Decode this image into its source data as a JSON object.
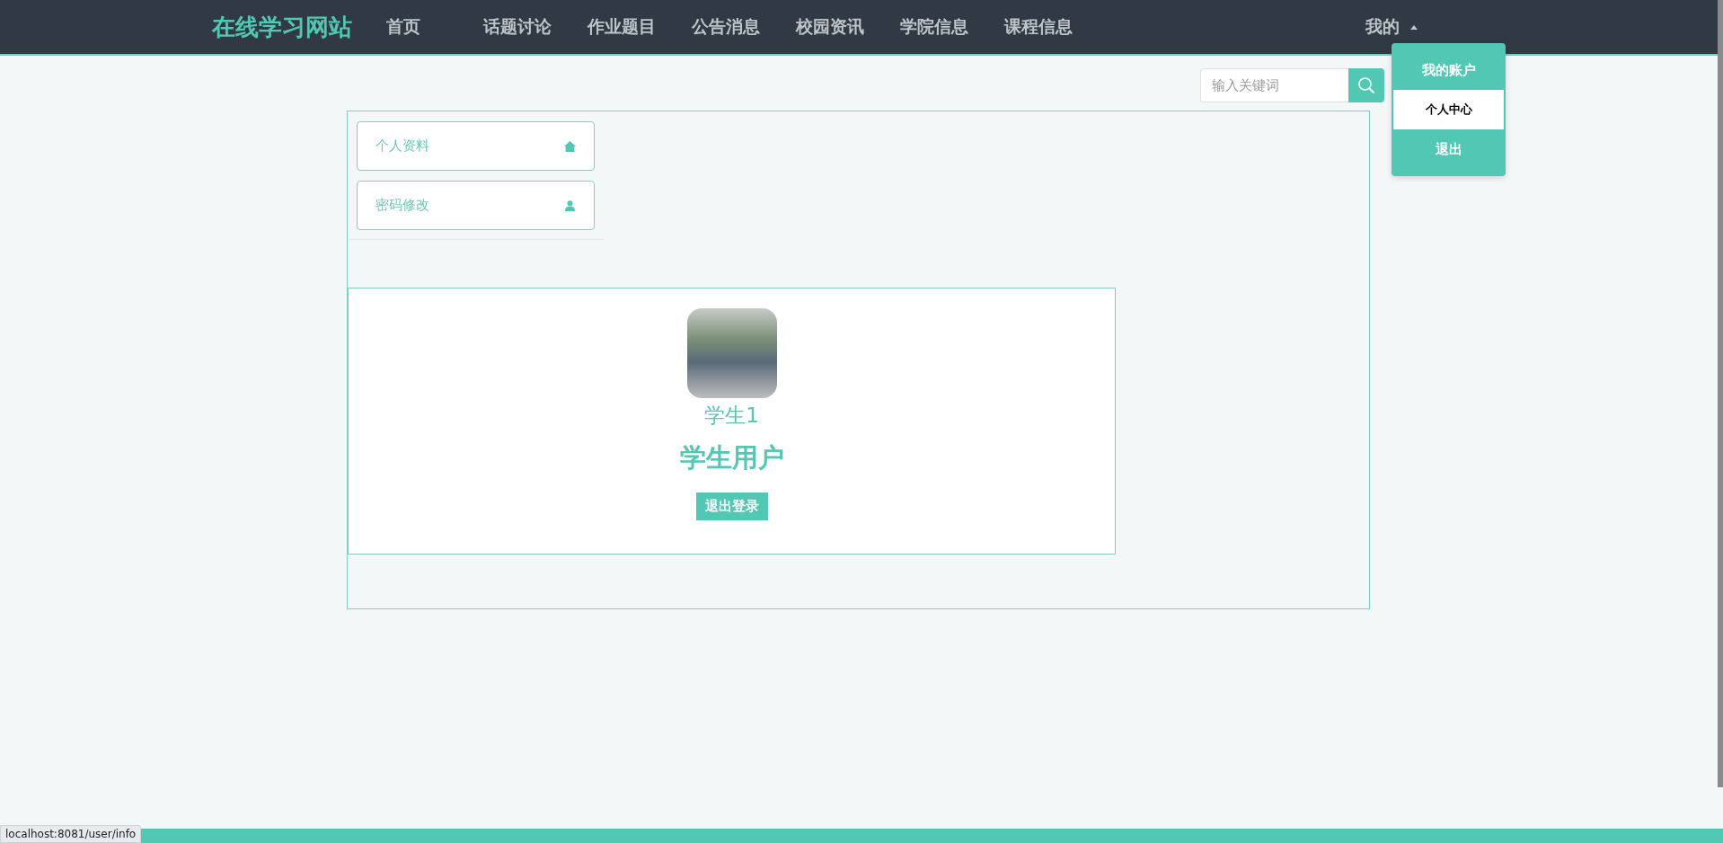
{
  "nav": {
    "logo": "在线学习网站",
    "items": [
      {
        "label": "首页"
      },
      {
        "label": "话题讨论"
      },
      {
        "label": "作业题目"
      },
      {
        "label": "公告消息"
      },
      {
        "label": "校园资讯"
      },
      {
        "label": "学院信息"
      },
      {
        "label": "课程信息"
      }
    ],
    "account": {
      "label": "我的",
      "expanded": true
    }
  },
  "account_menu": [
    {
      "label": "我的账户",
      "highlighted": false
    },
    {
      "label": "个人中心",
      "highlighted": true
    },
    {
      "label": "退出",
      "highlighted": false
    }
  ],
  "search": {
    "placeholder": "输入关键词"
  },
  "sidebar": {
    "items": [
      {
        "label": "个人资料"
      },
      {
        "label": "密码修改"
      }
    ]
  },
  "profile": {
    "name": "学生1",
    "role": "学生用户",
    "logout_button": "退出登录"
  },
  "status_bar": {
    "url": "localhost:8081/user/info"
  }
}
